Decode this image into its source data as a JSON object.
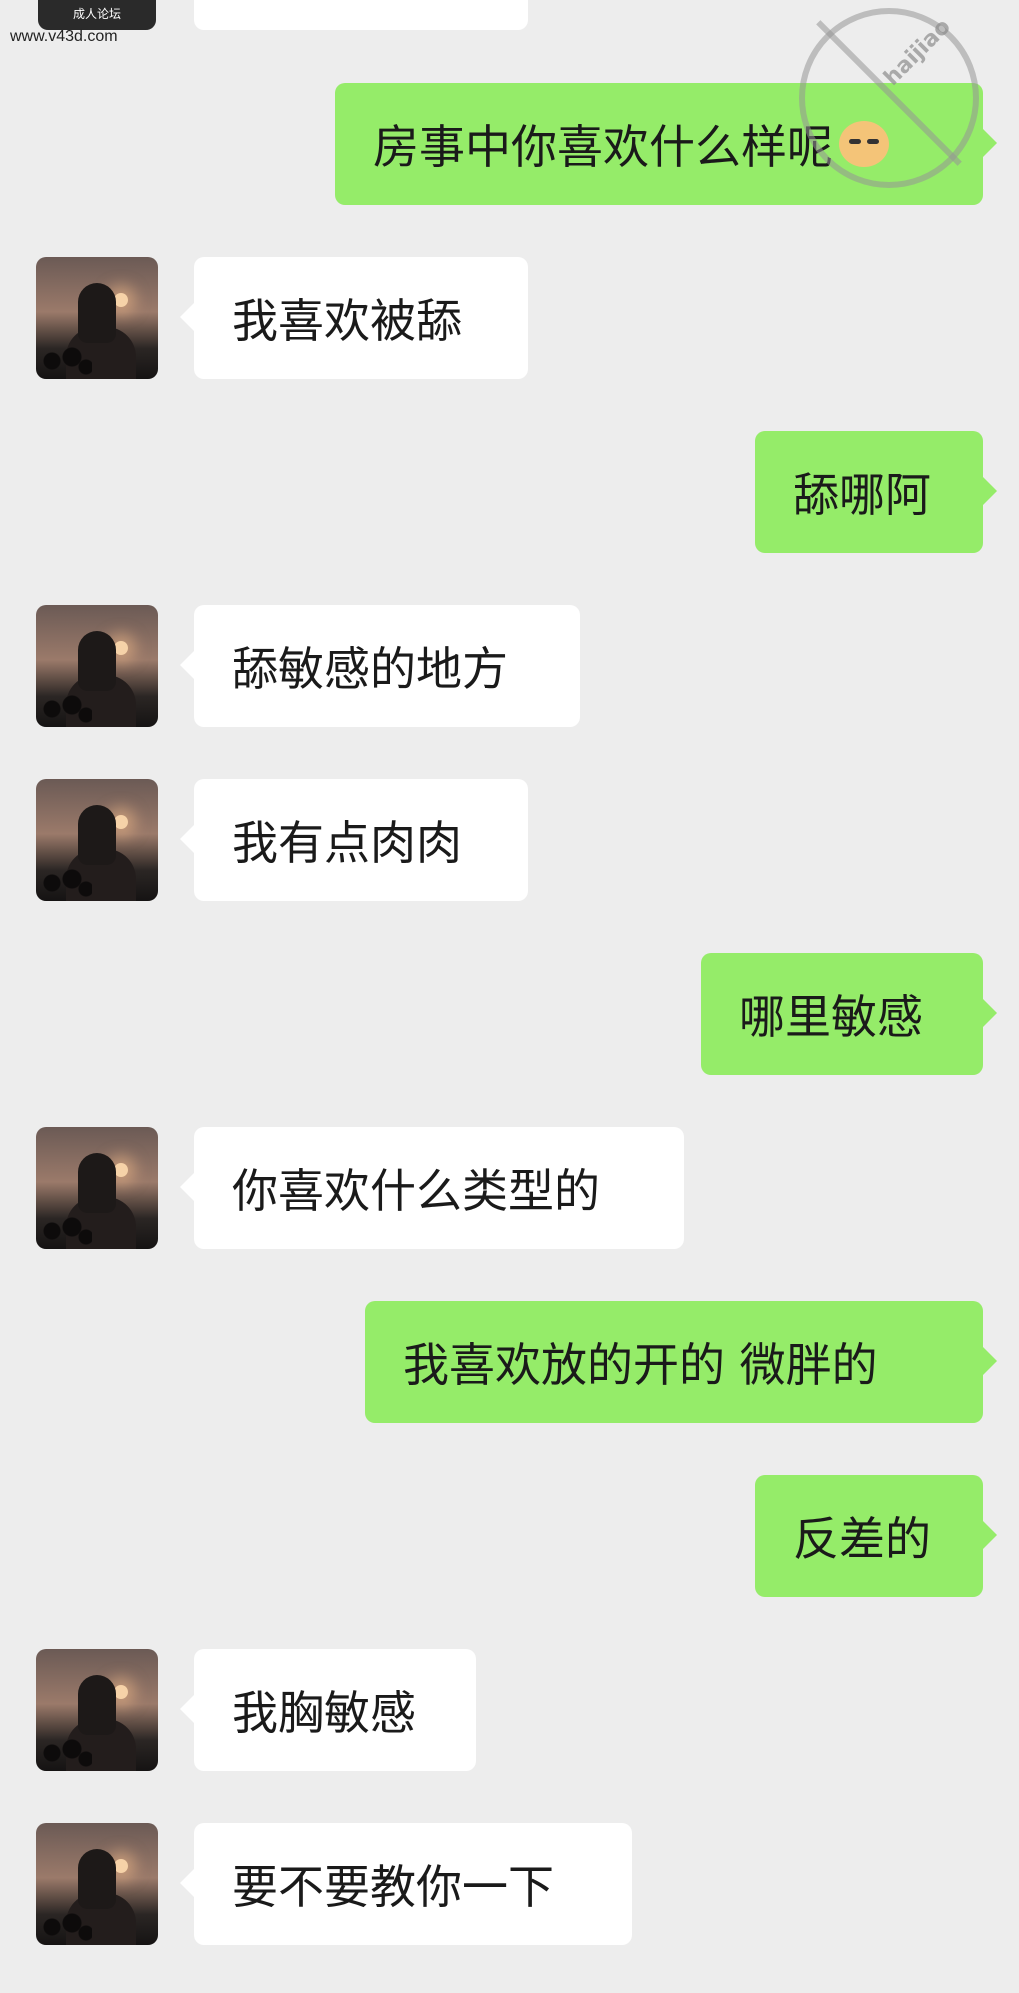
{
  "watermark": {
    "site": "www.v43d.com",
    "badge": "成人论坛",
    "circle_text": "haijiao"
  },
  "colors": {
    "background": "#ededed",
    "incoming_bubble": "#ffffff",
    "outgoing_bubble": "#95ec69"
  },
  "messages": [
    {
      "side": "in",
      "text": ""
    },
    {
      "side": "out",
      "text": "房事中你喜欢什么样呢",
      "emoji": "cat-face-icon"
    },
    {
      "side": "in",
      "text": "我喜欢被舔"
    },
    {
      "side": "out",
      "text": "舔哪阿"
    },
    {
      "side": "in",
      "text": "舔敏感的地方"
    },
    {
      "side": "in",
      "text": "我有点肉肉"
    },
    {
      "side": "out",
      "text": "哪里敏感"
    },
    {
      "side": "in",
      "text": "你喜欢什么类型的"
    },
    {
      "side": "out",
      "text": "我喜欢放的开的  微胖的"
    },
    {
      "side": "out",
      "text": "反差的"
    },
    {
      "side": "in",
      "text": "我胸敏感"
    },
    {
      "side": "in",
      "text": "要不要教你一下"
    }
  ]
}
